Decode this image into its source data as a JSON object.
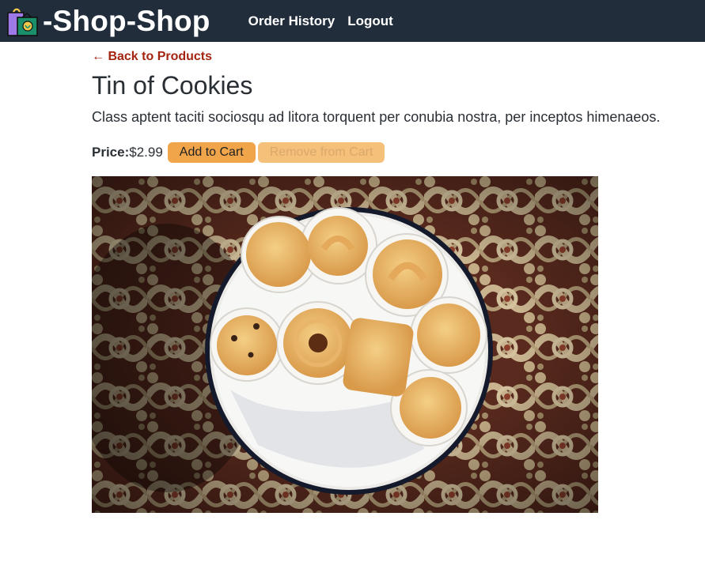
{
  "navbar": {
    "brand_icon": "shopping-bag-icon",
    "brand_text": "-Shop-Shop",
    "links": [
      {
        "label": "Order History"
      },
      {
        "label": "Logout"
      }
    ],
    "background": "#222d3c"
  },
  "product": {
    "back_link": "← Back to Products",
    "name": "Tin of Cookies",
    "description": "Class aptent taciti sociosqu ad litora torquent per conubia nostra, per inceptos himenaeos.",
    "price_label": "Price:",
    "price_value": "$2.99",
    "add_button": "Add to Cart",
    "remove_button": "Remove from Cart",
    "image_alt": "Tin of Cookies"
  },
  "colors": {
    "accent": "#f0a54b",
    "accent_disabled": "#f4c07a",
    "link": "#a3250f"
  }
}
